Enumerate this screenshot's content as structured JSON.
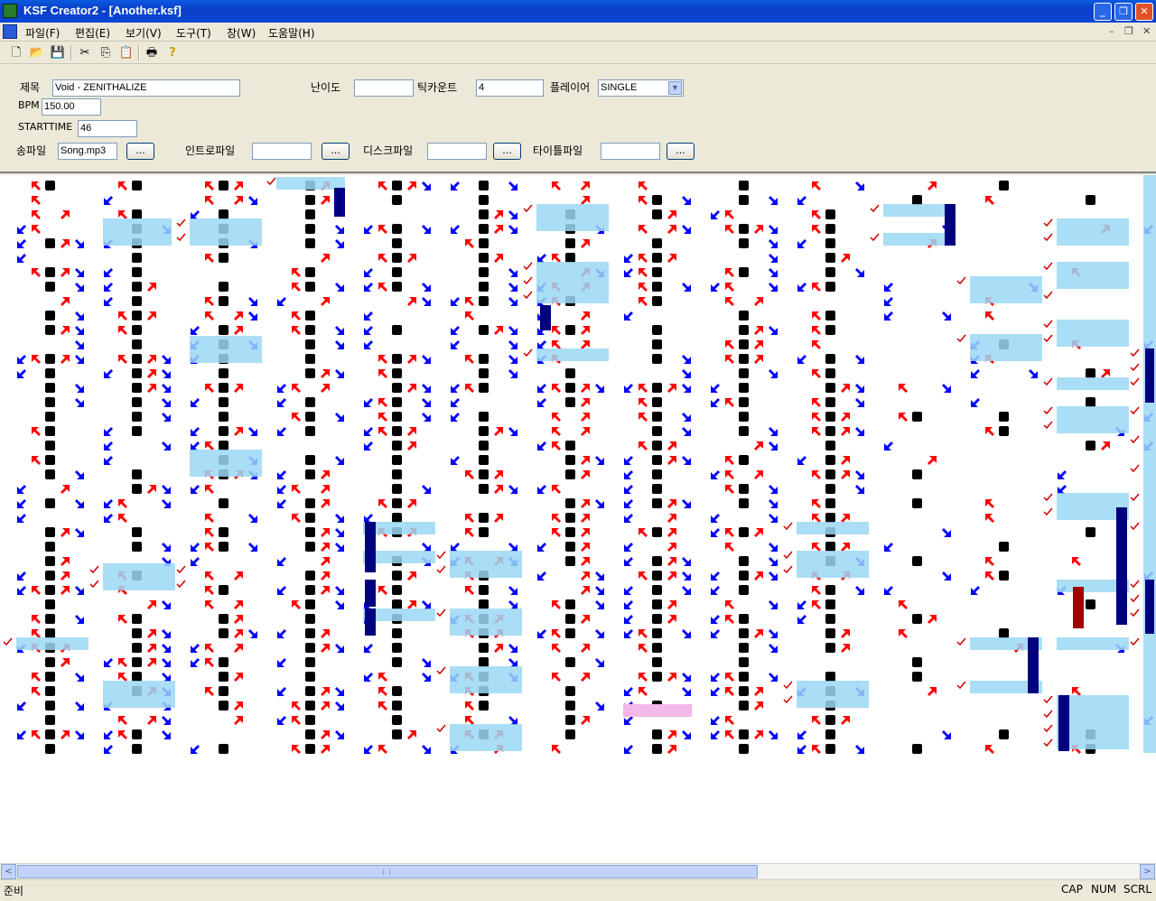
{
  "window": {
    "title": "KSF Creator2 - [Another.ksf]",
    "minimize_glyph": "_",
    "restore_glyph": "❐",
    "close_glyph": "✕"
  },
  "menu": {
    "items": [
      "파일(F)",
      "편집(E)",
      "보기(V)",
      "도구(T)",
      "창(W)",
      "도움말(H)"
    ],
    "mdi_controls": [
      "–",
      "❐",
      "✕"
    ]
  },
  "toolbar": {
    "icons": [
      "new-file-icon",
      "open-folder-icon",
      "save-icon",
      "cut-icon",
      "copy-icon",
      "paste-icon",
      "print-icon",
      "help-icon"
    ],
    "glyphs": [
      "🗋",
      "📂",
      "💾",
      "✂",
      "⎘",
      "📋",
      "🖶",
      "?"
    ]
  },
  "form": {
    "title_label": "제목",
    "title_value": "Void - ZENITHALIZE",
    "bpm_label": "BPM",
    "bpm_value": "150.00",
    "starttime_label": "STARTTIME",
    "starttime_value": "46",
    "difficulty_label": "난이도",
    "difficulty_value": "",
    "tickcount_label": "틱카운트",
    "tickcount_value": "4",
    "player_label": "플레이어",
    "player_value": "SINGLE",
    "songfile_label": "송파일",
    "songfile_value": "Song.mp3",
    "introfile_label": "인트로파일",
    "introfile_value": "",
    "discfile_label": "디스크파일",
    "discfile_value": "",
    "titlefile_label": "타이틀파일",
    "titlefile_value": "",
    "browse_label": "..."
  },
  "chart": {
    "colors": {
      "blue": "#0000ff",
      "red": "#ff0000",
      "black": "#000000",
      "hold": "#9bd7f5",
      "longnote": "#000080",
      "check": "#d00000",
      "pink": "#f4b8e8"
    }
  },
  "scrollbar": {
    "left_glyph": "<",
    "right_glyph": ">"
  },
  "status": {
    "text": "준비",
    "indicators": [
      "CAP",
      "NUM",
      "SCRL"
    ]
  }
}
